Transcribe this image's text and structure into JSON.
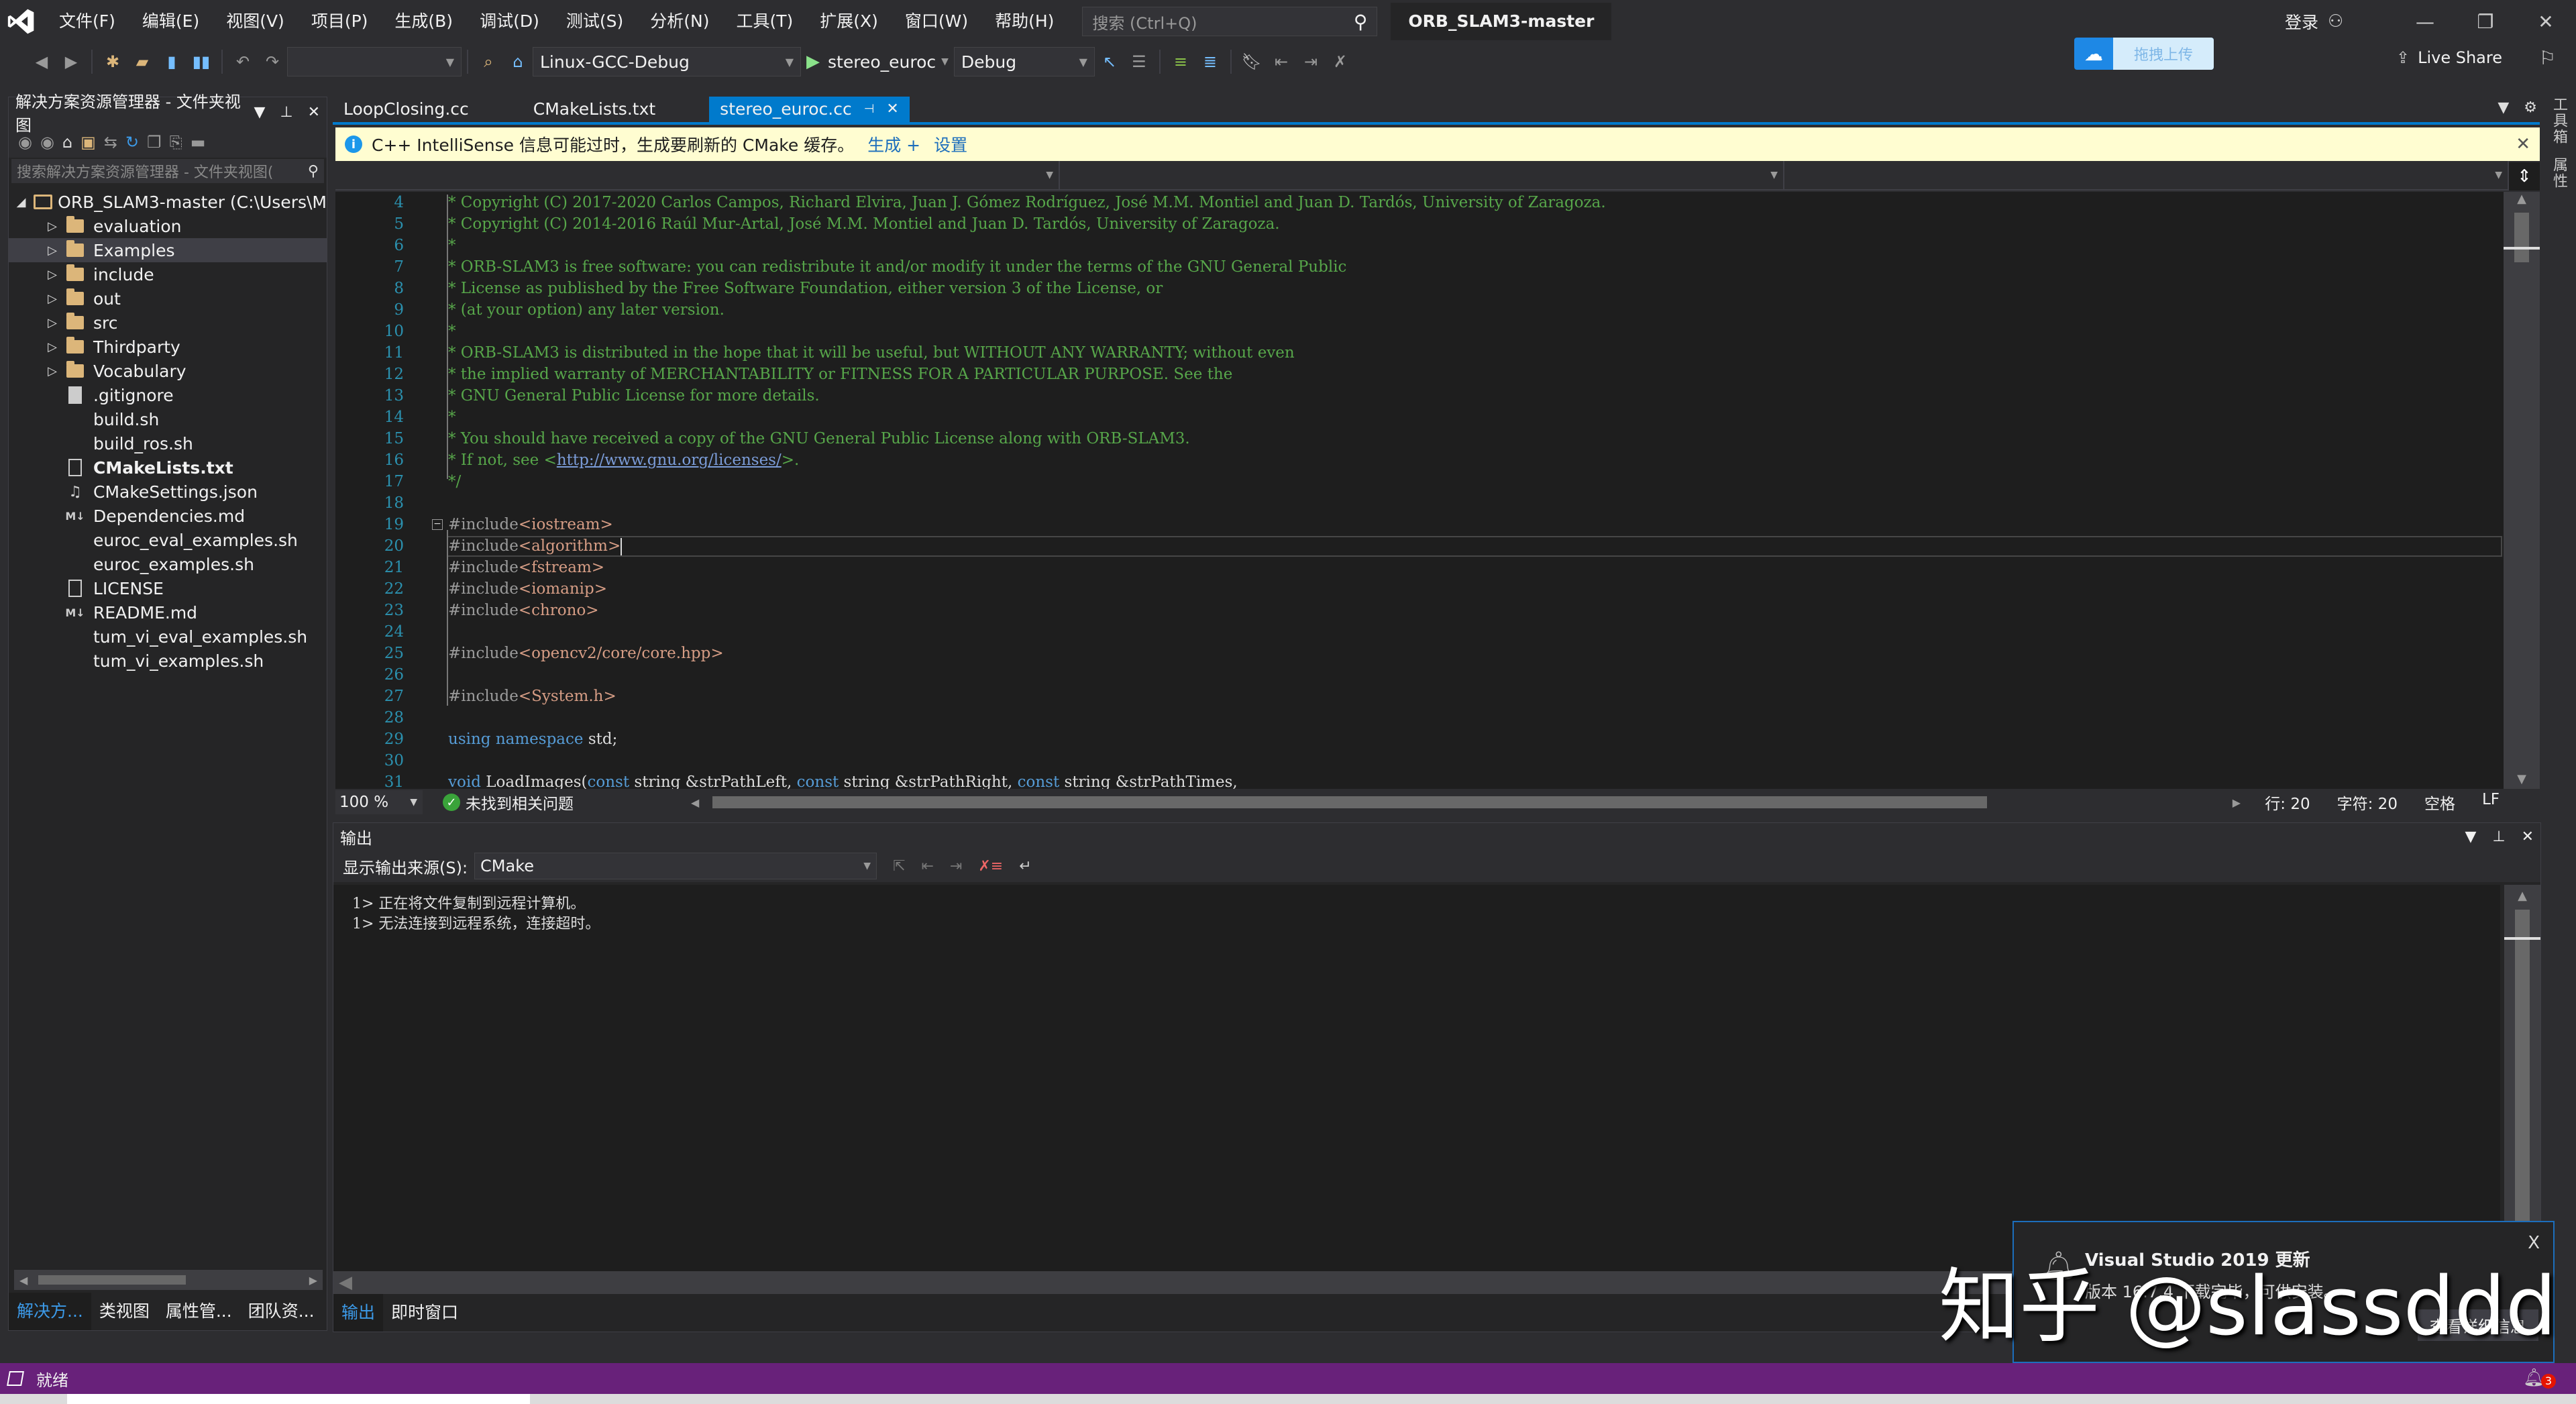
{
  "titlebar": {
    "menu": [
      "文件(F)",
      "编辑(E)",
      "视图(V)",
      "项目(P)",
      "生成(B)",
      "调试(D)",
      "测试(S)",
      "分析(N)",
      "工具(T)",
      "扩展(X)",
      "窗口(W)",
      "帮助(H)"
    ],
    "search_placeholder": "搜索 (Ctrl+Q)",
    "solution_name": "ORB_SLAM3-master",
    "login": "登录",
    "minimize": "—",
    "restore": "❐",
    "close": "✕"
  },
  "toolbar": {
    "config_combo": "",
    "platform": "Linux-GCC-Debug",
    "startup_item": "stereo_euroc",
    "build_config": "Debug",
    "baidu_upload": "拖拽上传",
    "live_share": "Live Share"
  },
  "solution_explorer": {
    "title": "解决方案资源管理器 - 文件夹视图",
    "search_placeholder": "搜索解决方案资源管理器 - 文件夹视图(",
    "root": "ORB_SLAM3-master (C:\\Users\\M",
    "items": [
      {
        "label": "evaluation",
        "type": "folder"
      },
      {
        "label": "Examples",
        "type": "folder",
        "selected": true
      },
      {
        "label": "include",
        "type": "folder"
      },
      {
        "label": "out",
        "type": "folder"
      },
      {
        "label": "src",
        "type": "folder"
      },
      {
        "label": "Thirdparty",
        "type": "folder"
      },
      {
        "label": "Vocabulary",
        "type": "folder"
      },
      {
        "label": ".gitignore",
        "type": "file"
      },
      {
        "label": "build.sh",
        "type": "none"
      },
      {
        "label": "build_ros.sh",
        "type": "none"
      },
      {
        "label": "CMakeLists.txt",
        "type": "doc",
        "bold": true
      },
      {
        "label": "CMakeSettings.json",
        "type": "json"
      },
      {
        "label": "Dependencies.md",
        "type": "md"
      },
      {
        "label": "euroc_eval_examples.sh",
        "type": "none"
      },
      {
        "label": "euroc_examples.sh",
        "type": "none"
      },
      {
        "label": "LICENSE",
        "type": "blank"
      },
      {
        "label": "README.md",
        "type": "md"
      },
      {
        "label": "tum_vi_eval_examples.sh",
        "type": "none"
      },
      {
        "label": "tum_vi_examples.sh",
        "type": "none"
      }
    ],
    "bottom_tabs": [
      "解决方...",
      "类视图",
      "属性管...",
      "团队资..."
    ]
  },
  "editor": {
    "tabs": [
      {
        "label": "LoopClosing.cc",
        "active": false
      },
      {
        "label": "CMakeLists.txt",
        "active": false
      },
      {
        "label": "stereo_euroc.cc",
        "active": true
      }
    ],
    "infobar": {
      "message": "C++ IntelliSense 信息可能过时，生成要刷新的 CMake 缓存。",
      "link_build": "生成 +",
      "link_settings": "设置"
    },
    "lines": [
      {
        "n": "4",
        "parts": [
          [
            "cmt",
            "* Copyright (C) 2017-2020 Carlos Campos, Richard Elvira, Juan J. Gómez Rodríguez, José M.M. Montiel and Juan D. Tardós, University of Zaragoza."
          ]
        ]
      },
      {
        "n": "5",
        "parts": [
          [
            "cmt",
            "* Copyright (C) 2014-2016 Raúl Mur-Artal, José M.M. Montiel and Juan D. Tardós, University of Zaragoza."
          ]
        ]
      },
      {
        "n": "6",
        "parts": [
          [
            "cmt",
            "*"
          ]
        ]
      },
      {
        "n": "7",
        "parts": [
          [
            "cmt",
            "* ORB-SLAM3 is free software: you can redistribute it and/or modify it under the terms of the GNU General Public"
          ]
        ]
      },
      {
        "n": "8",
        "parts": [
          [
            "cmt",
            "* License as published by the Free Software Foundation, either version 3 of the License, or"
          ]
        ]
      },
      {
        "n": "9",
        "parts": [
          [
            "cmt",
            "* (at your option) any later version."
          ]
        ]
      },
      {
        "n": "10",
        "parts": [
          [
            "cmt",
            "*"
          ]
        ]
      },
      {
        "n": "11",
        "parts": [
          [
            "cmt",
            "* ORB-SLAM3 is distributed in the hope that it will be useful, but WITHOUT ANY WARRANTY; without even"
          ]
        ]
      },
      {
        "n": "12",
        "parts": [
          [
            "cmt",
            "* the implied warranty of MERCHANTABILITY or FITNESS FOR A PARTICULAR PURPOSE. See the"
          ]
        ]
      },
      {
        "n": "13",
        "parts": [
          [
            "cmt",
            "* GNU General Public License for more details."
          ]
        ]
      },
      {
        "n": "14",
        "parts": [
          [
            "cmt",
            "*"
          ]
        ]
      },
      {
        "n": "15",
        "parts": [
          [
            "cmt",
            "* You should have received a copy of the GNU General Public License along with ORB-SLAM3."
          ]
        ]
      },
      {
        "n": "16",
        "parts": [
          [
            "cmt",
            "* If not, see <"
          ],
          [
            "url",
            "http://www.gnu.org/licenses/"
          ],
          [
            "cmt",
            ">."
          ]
        ]
      },
      {
        "n": "17",
        "parts": [
          [
            "cmt",
            "*/"
          ]
        ]
      },
      {
        "n": "18",
        "parts": []
      },
      {
        "n": "19",
        "parts": [
          [
            "pp",
            "#include"
          ],
          [
            "str",
            "<iostream>"
          ]
        ],
        "fold": true
      },
      {
        "n": "20",
        "parts": [
          [
            "pp",
            "#include"
          ],
          [
            "str",
            "<algorithm>"
          ]
        ],
        "current": true
      },
      {
        "n": "21",
        "parts": [
          [
            "pp",
            "#include"
          ],
          [
            "str",
            "<fstream>"
          ]
        ]
      },
      {
        "n": "22",
        "parts": [
          [
            "pp",
            "#include"
          ],
          [
            "str",
            "<iomanip>"
          ]
        ]
      },
      {
        "n": "23",
        "parts": [
          [
            "pp",
            "#include"
          ],
          [
            "str",
            "<chrono>"
          ]
        ]
      },
      {
        "n": "24",
        "parts": []
      },
      {
        "n": "25",
        "parts": [
          [
            "pp",
            "#include"
          ],
          [
            "str",
            "<opencv2/core/core.hpp>"
          ]
        ]
      },
      {
        "n": "26",
        "parts": []
      },
      {
        "n": "27",
        "parts": [
          [
            "pp",
            "#include"
          ],
          [
            "str",
            "<System.h>"
          ]
        ]
      },
      {
        "n": "28",
        "parts": []
      },
      {
        "n": "29",
        "parts": [
          [
            "kw",
            "using"
          ],
          [
            "code",
            " "
          ],
          [
            "kw",
            "namespace"
          ],
          [
            "code",
            " std;"
          ]
        ]
      },
      {
        "n": "30",
        "parts": []
      },
      {
        "n": "31",
        "parts": [
          [
            "kw",
            "void"
          ],
          [
            "code",
            " LoadImages("
          ],
          [
            "kw",
            "const"
          ],
          [
            "code",
            " string &strPathLeft, "
          ],
          [
            "kw",
            "const"
          ],
          [
            "code",
            " string &strPathRight, "
          ],
          [
            "kw",
            "const"
          ],
          [
            "code",
            " string &strPathTimes,"
          ]
        ]
      }
    ],
    "status": {
      "zoom": "100 %",
      "issues": "未找到相关问题",
      "line": "行: 20",
      "char": "字符: 20",
      "indent": "空格",
      "eol": "LF"
    }
  },
  "output": {
    "title": "输出",
    "source_label": "显示输出来源(S):",
    "source_value": "CMake",
    "lines": [
      "1> 正在将文件复制到远程计算机。",
      "1> 无法连接到远程系统，连接超时。"
    ],
    "bottom_tabs": [
      "输出",
      "即时窗口"
    ]
  },
  "side_tabs": [
    "工具箱",
    "属性"
  ],
  "statusbar": {
    "text": "就绪",
    "notification_count": "3"
  },
  "toast": {
    "title": "Visual Studio 2019 更新",
    "message": "版本 16.7.4 下载完毕，可供安装。",
    "details_button": "查看详细信息",
    "close": "X"
  },
  "watermark": "知乎 @slassddd"
}
